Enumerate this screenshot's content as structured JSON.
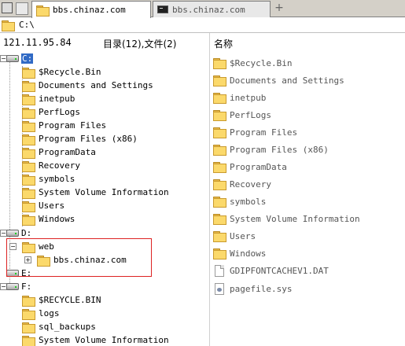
{
  "tabs": [
    {
      "label": "bbs.chinaz.com",
      "active": true,
      "icon": "folder-icon"
    },
    {
      "label": "bbs.chinaz.com",
      "active": false,
      "icon": "terminal-icon"
    }
  ],
  "new_tab_label": "+",
  "address": {
    "path": "C:\\"
  },
  "header": {
    "ip": "121.11.95.84",
    "counts": "目录(12),文件(2)",
    "name_col": "名称"
  },
  "tree": {
    "drive_c": "C:",
    "c_items": [
      "$Recycle.Bin",
      "Documents and Settings",
      "inetpub",
      "PerfLogs",
      "Program Files",
      "Program Files (x86)",
      "ProgramData",
      "Recovery",
      "symbols",
      "System Volume Information",
      "Users",
      "Windows"
    ],
    "drive_d": "D:",
    "web": "web",
    "web_child": "bbs.chinaz.com",
    "drive_e": "E:",
    "drive_f": "F:",
    "f_items": [
      "$RECYCLE.BIN",
      "logs",
      "sql_backups",
      "System Volume Information"
    ]
  },
  "list": {
    "folders": [
      "$Recycle.Bin",
      "Documents and Settings",
      "inetpub",
      "PerfLogs",
      "Program Files",
      "Program Files (x86)",
      "ProgramData",
      "Recovery",
      "symbols",
      "System Volume Information",
      "Users",
      "Windows"
    ],
    "files": [
      {
        "name": "GDIPFONTCACHEV1.DAT",
        "icon": "document-icon"
      },
      {
        "name": "pagefile.sys",
        "icon": "system-file-icon"
      }
    ]
  },
  "colors": {
    "selection": "#316ac5",
    "highlight_box": "#dd2222",
    "folder": "#fbd96b"
  }
}
